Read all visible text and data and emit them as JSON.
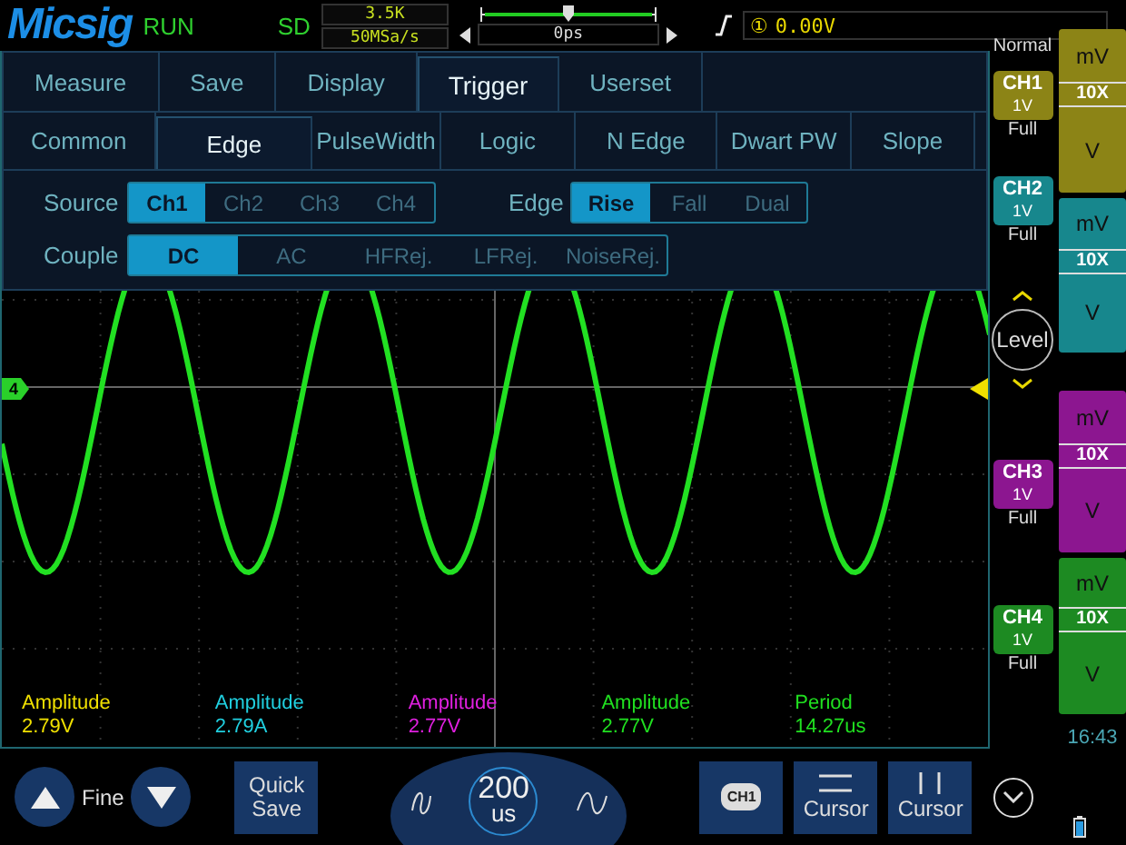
{
  "header": {
    "logo": "Micsig",
    "run_state": "RUN",
    "storage": "SD",
    "memory_depth": "3.5K",
    "sample_rate": "50MSa/s",
    "time_offset": "0ps",
    "trigger_channel": "①",
    "trigger_level": "0.00V"
  },
  "menu": {
    "tabs": [
      {
        "label": "Measure",
        "selected": false
      },
      {
        "label": "Save",
        "selected": false
      },
      {
        "label": "Display",
        "selected": false
      },
      {
        "label": "Trigger",
        "selected": true
      },
      {
        "label": "Userset",
        "selected": false
      }
    ],
    "subtabs": [
      {
        "label": "Common",
        "selected": false
      },
      {
        "label": "Edge",
        "selected": true
      },
      {
        "label": "PulseWidth",
        "selected": false
      },
      {
        "label": "Logic",
        "selected": false
      },
      {
        "label": "N Edge",
        "selected": false
      },
      {
        "label": "Dwart PW",
        "selected": false
      },
      {
        "label": "Slope",
        "selected": false
      }
    ],
    "source": {
      "label": "Source",
      "options": [
        {
          "label": "Ch1",
          "selected": true
        },
        {
          "label": "Ch2",
          "selected": false
        },
        {
          "label": "Ch3",
          "selected": false
        },
        {
          "label": "Ch4",
          "selected": false
        }
      ]
    },
    "edge": {
      "label": "Edge",
      "options": [
        {
          "label": "Rise",
          "selected": true
        },
        {
          "label": "Fall",
          "selected": false
        },
        {
          "label": "Dual",
          "selected": false
        }
      ]
    },
    "couple": {
      "label": "Couple",
      "options": [
        {
          "label": "DC",
          "selected": true
        },
        {
          "label": "AC",
          "selected": false
        },
        {
          "label": "HFRej.",
          "selected": false
        },
        {
          "label": "LFRej.",
          "selected": false
        },
        {
          "label": "NoiseRej.",
          "selected": false
        }
      ]
    }
  },
  "ground_marker": "4",
  "measurements": [
    {
      "label": "Amplitude",
      "value": "2.79V",
      "color": "#f0e000"
    },
    {
      "label": "Amplitude",
      "value": "2.79A",
      "color": "#20d0e0"
    },
    {
      "label": "Amplitude",
      "value": "2.77V",
      "color": "#e020e0"
    },
    {
      "label": "Amplitude",
      "value": "2.77V",
      "color": "#20e020"
    },
    {
      "label": "Period",
      "value": "14.27us",
      "color": "#20e020"
    }
  ],
  "trigger_mode": "Normal",
  "level_button": "Level",
  "channels": [
    {
      "label": "CH1",
      "scale": "1V",
      "bandwidth": "Full",
      "color": "#8c8416",
      "units": [
        "mV",
        "10X",
        "V"
      ]
    },
    {
      "label": "CH2",
      "scale": "1V",
      "bandwidth": "Full",
      "color": "#17878d",
      "units": [
        "mV",
        "10X",
        "V"
      ]
    },
    {
      "label": "CH3",
      "scale": "1V",
      "bandwidth": "Full",
      "color": "#8c1690",
      "units": [
        "mV",
        "10X",
        "V"
      ]
    },
    {
      "label": "CH4",
      "scale": "1V",
      "bandwidth": "Full",
      "color": "#1d8a22",
      "units": [
        "mV",
        "10X",
        "V"
      ]
    }
  ],
  "clock": "16:43",
  "bottom": {
    "fine_label": "Fine",
    "quick_save": "Quick Save",
    "timebase_value": "200",
    "timebase_unit": "us",
    "channel_button": "CH1",
    "cursor_buttons": [
      "Cursor",
      "Cursor"
    ]
  }
}
